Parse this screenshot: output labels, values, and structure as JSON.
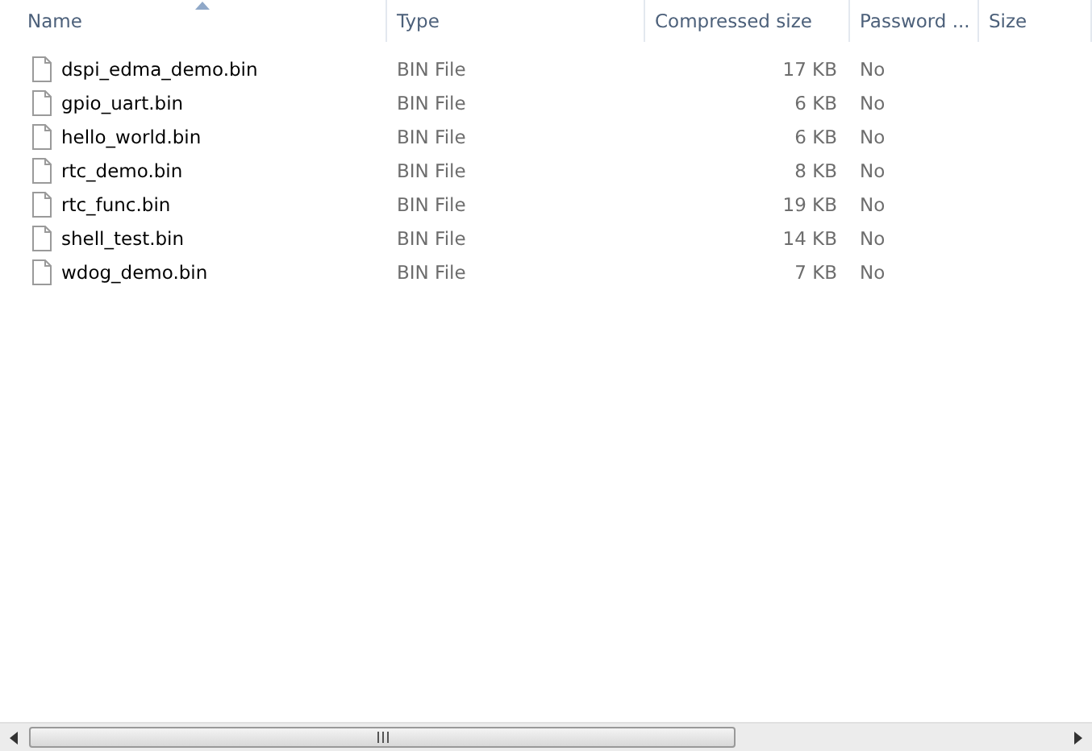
{
  "columns": [
    {
      "label": "Name",
      "sorted": true
    },
    {
      "label": "Type",
      "sorted": false
    },
    {
      "label": "Compressed size",
      "sorted": false
    },
    {
      "label": "Password ...",
      "sorted": false
    },
    {
      "label": "Size",
      "sorted": false
    }
  ],
  "rows": [
    {
      "name": "dspi_edma_demo.bin",
      "type": "BIN File",
      "compressed": "17 KB",
      "password": "No"
    },
    {
      "name": "gpio_uart.bin",
      "type": "BIN File",
      "compressed": "6 KB",
      "password": "No"
    },
    {
      "name": "hello_world.bin",
      "type": "BIN File",
      "compressed": "6 KB",
      "password": "No"
    },
    {
      "name": "rtc_demo.bin",
      "type": "BIN File",
      "compressed": "8 KB",
      "password": "No"
    },
    {
      "name": "rtc_func.bin",
      "type": "BIN File",
      "compressed": "19 KB",
      "password": "No"
    },
    {
      "name": "shell_test.bin",
      "type": "BIN File",
      "compressed": "14 KB",
      "password": "No"
    },
    {
      "name": "wdog_demo.bin",
      "type": "BIN File",
      "compressed": "7 KB",
      "password": "No"
    }
  ]
}
